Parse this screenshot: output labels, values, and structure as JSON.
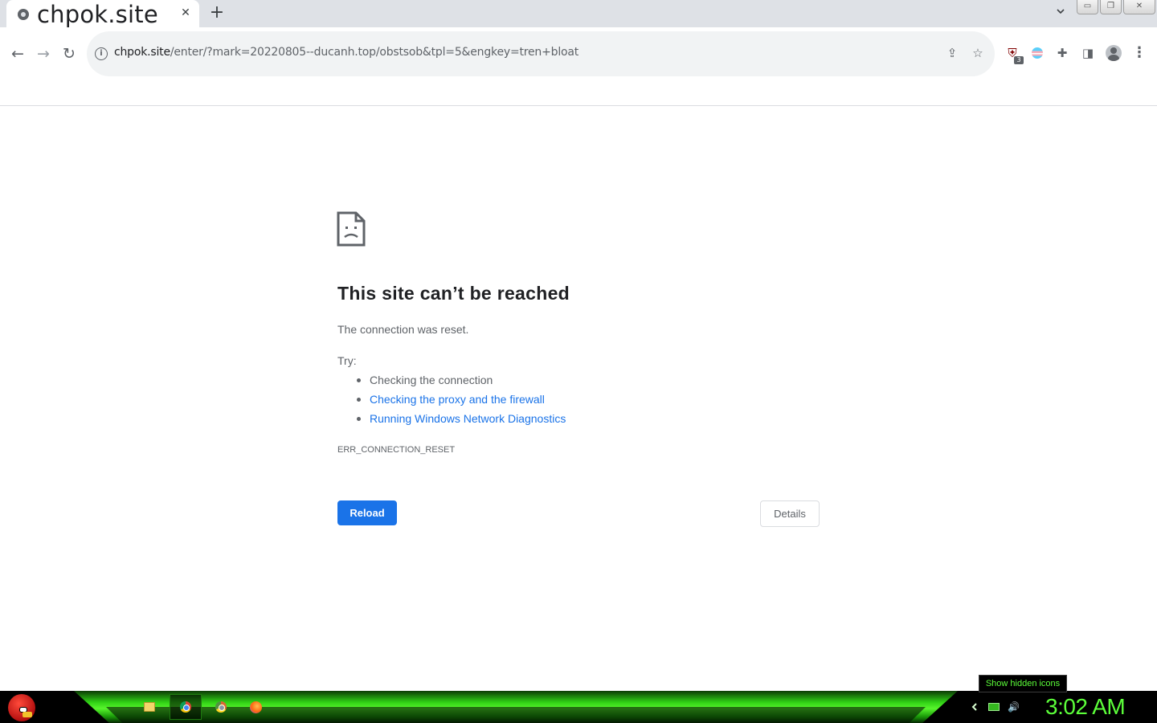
{
  "browser": {
    "tab": {
      "title": "chpok.site",
      "close_glyph": "✕",
      "favicon": "globe-icon"
    },
    "new_tab_glyph": "+",
    "window_controls": {
      "minimize": "▭",
      "restore": "❐",
      "close": "✕"
    },
    "toolbar": {
      "back_glyph": "←",
      "forward_glyph": "→",
      "reload_glyph": "↻",
      "url_host": "chpok.site",
      "url_path": "/enter/?mark=20220805--ducanh.top/obstsob&tpl=5&engkey=tren+bloat",
      "info_glyph": "i",
      "share_glyph": "⇪",
      "bookmark_glyph": "☆",
      "extensions": [
        {
          "name": "ublock-origin",
          "glyph": "⛨",
          "badge": "3"
        },
        {
          "name": "flag-extension",
          "glyph": ""
        },
        {
          "name": "extensions-puzzle",
          "glyph": "✚"
        },
        {
          "name": "side-panel",
          "glyph": "◨"
        },
        {
          "name": "profile-avatar",
          "glyph": ""
        },
        {
          "name": "menu",
          "glyph": "⋮"
        }
      ]
    }
  },
  "error_page": {
    "title": "This site can’t be reached",
    "subtitle": "The connection was reset.",
    "try_label": "Try:",
    "suggestions": [
      {
        "text": "Checking the connection",
        "link": false
      },
      {
        "text": "Checking the proxy and the firewall",
        "link": true
      },
      {
        "text": "Running Windows Network Diagnostics",
        "link": true
      }
    ],
    "error_code": "ERR_CONNECTION_RESET",
    "reload_label": "Reload",
    "details_label": "Details"
  },
  "taskbar": {
    "apps": [
      "folder-icon",
      "chrome-icon",
      "chrome-canary-icon",
      "firefox-icon"
    ],
    "active_app": "chrome-icon",
    "tray": {
      "volume_glyph": "🔊"
    },
    "clock": "3:02 AM",
    "tooltip": "Show hidden icons",
    "accent": "#5cff3a"
  },
  "colors": {
    "link": "#1a73e8",
    "primary_button": "#1a73e8",
    "text_primary": "#202124",
    "text_secondary": "#5f6368"
  }
}
